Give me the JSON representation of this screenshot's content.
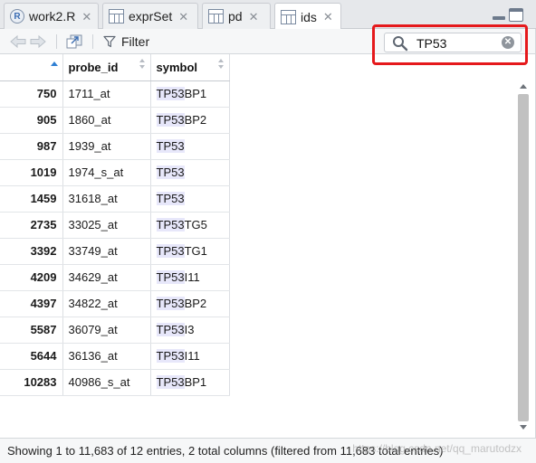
{
  "tabs": [
    {
      "label": "work2.R",
      "icon": "r-script-icon",
      "active": false
    },
    {
      "label": "exprSet",
      "icon": "data-grid-icon",
      "active": false
    },
    {
      "label": "pd",
      "icon": "data-grid-icon",
      "active": false
    },
    {
      "label": "ids",
      "icon": "data-grid-icon",
      "active": true
    }
  ],
  "tab_close_glyph": "✕",
  "toolbar": {
    "filter_label": "Filter",
    "search_value": "TP53"
  },
  "table": {
    "columns": [
      "",
      "probe_id",
      "symbol"
    ],
    "sorted_column": "row-number",
    "rows": [
      {
        "row": "750",
        "probe_id": "1711_at",
        "symbol_match": "TP53",
        "symbol_rest": "BP1"
      },
      {
        "row": "905",
        "probe_id": "1860_at",
        "symbol_match": "TP53",
        "symbol_rest": "BP2"
      },
      {
        "row": "987",
        "probe_id": "1939_at",
        "symbol_match": "TP53",
        "symbol_rest": ""
      },
      {
        "row": "1019",
        "probe_id": "1974_s_at",
        "symbol_match": "TP53",
        "symbol_rest": ""
      },
      {
        "row": "1459",
        "probe_id": "31618_at",
        "symbol_match": "TP53",
        "symbol_rest": ""
      },
      {
        "row": "2735",
        "probe_id": "33025_at",
        "symbol_match": "TP53",
        "symbol_rest": "TG5"
      },
      {
        "row": "3392",
        "probe_id": "33749_at",
        "symbol_match": "TP53",
        "symbol_rest": "TG1"
      },
      {
        "row": "4209",
        "probe_id": "34629_at",
        "symbol_match": "TP53",
        "symbol_rest": "I11"
      },
      {
        "row": "4397",
        "probe_id": "34822_at",
        "symbol_match": "TP53",
        "symbol_rest": "BP2"
      },
      {
        "row": "5587",
        "probe_id": "36079_at",
        "symbol_match": "TP53",
        "symbol_rest": "I3"
      },
      {
        "row": "5644",
        "probe_id": "36136_at",
        "symbol_match": "TP53",
        "symbol_rest": "I11"
      },
      {
        "row": "10283",
        "probe_id": "40986_s_at",
        "symbol_match": "TP53",
        "symbol_rest": "BP1"
      }
    ]
  },
  "status": "Showing 1 to 11,683 of 12 entries, 2 total columns (filtered from 11,683 total entries)",
  "watermark": "https://blog.csdn.net/qq_marutodzx",
  "colors": {
    "highlight_box": "#e5191c",
    "match_highlight": "#e7e7fa",
    "sort_arrow": "#2f7fd3"
  }
}
